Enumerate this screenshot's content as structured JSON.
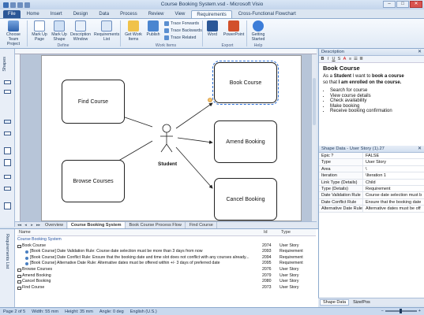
{
  "window": {
    "title": "Course Booking System.vsd - Microsoft Visio",
    "minimize": "–",
    "maximize": "□",
    "close": "✕"
  },
  "ribbon_tabs": [
    "File",
    "Home",
    "Insert",
    "Design",
    "Data",
    "Process",
    "Review",
    "View",
    "Requirements",
    "Cross-Functional Flowchart"
  ],
  "active_tab": "Requirements",
  "ribbon": {
    "choose_team_project": "Choose Team Project",
    "mark_up_page": "Mark Up Page",
    "mark_up_shape": "Mark Up Shape",
    "description_window": "Description Window",
    "requirements_list": "Requirements List",
    "get_work_items": "Get Work Items",
    "publish": "Publish",
    "trace_forwards": "Trace Forwards",
    "trace_backwards": "Trace Backwards",
    "trace_related": "Trace Related",
    "word": "Word",
    "powerpoint": "PowerPoint",
    "getting_started": "Getting Started",
    "group_define": "Define",
    "group_work_items": "Work Items",
    "group_export": "Export",
    "group_help": "Help"
  },
  "left_panel": {
    "label": "Shapes"
  },
  "diagram": {
    "shapes": {
      "find_course": "Find Course",
      "browse_courses": "Browse Courses",
      "book_course": "Book Course",
      "amend_booking": "Amend Booking",
      "cancel_booking": "Cancel Booking"
    },
    "actor": "Student"
  },
  "page_tabs": [
    "Overview",
    "Course Booking System",
    "Book Course Process Flow",
    "Find Course"
  ],
  "active_page": "Course Booking System",
  "requirements_list": {
    "side_label": "Requirements List",
    "columns": {
      "name": "Name",
      "id": "Id",
      "type": "Type"
    },
    "rows": [
      {
        "name": "Course Booking System",
        "id": "",
        "type": "",
        "kind": "group"
      },
      {
        "name": "Book Course",
        "id": "2074",
        "type": "User Story",
        "kind": "story"
      },
      {
        "name": "[Book Course] Date Validation Rule: Course date selection must be more than 3 days from now",
        "id": "2093",
        "type": "Requirement",
        "kind": "req"
      },
      {
        "name": "[Book Course] Date Conflict Rule: Ensure that the booking date and time slot does not conflict with any courses already...",
        "id": "2094",
        "type": "Requirement",
        "kind": "req"
      },
      {
        "name": "[Book Course] Alternative Date Rule: Alternative dates must be offered within +/- 3 days of preferred date",
        "id": "2095",
        "type": "Requirement",
        "kind": "req"
      },
      {
        "name": "Browse Courses",
        "id": "2076",
        "type": "User Story",
        "kind": "story"
      },
      {
        "name": "Amend Booking",
        "id": "2079",
        "type": "User Story",
        "kind": "story"
      },
      {
        "name": "Cancel Booking",
        "id": "2080",
        "type": "User Story",
        "kind": "story"
      },
      {
        "name": "Find Course",
        "id": "2073",
        "type": "User Story",
        "kind": "story"
      }
    ]
  },
  "description_panel": {
    "title": "Description",
    "heading": "Book Course",
    "line1_prefix": "As a ",
    "line1_bold1": "Student",
    "line1_mid": " I want to ",
    "line1_bold2": "book a course",
    "line2_prefix": "so that ",
    "line2_bold": "I am enrolled on the course.",
    "bullets": [
      "Search for course",
      "View course details",
      "Check availability",
      "Make booking",
      "Receive booking confirmation"
    ]
  },
  "shape_data": {
    "title": "Shape Data - User Story (1).27",
    "rows": [
      {
        "k": "Epic ?",
        "v": "FALSE"
      },
      {
        "k": "Type",
        "v": "User Story"
      },
      {
        "k": "Area",
        "v": "\\"
      },
      {
        "k": "Iteration",
        "v": "\\Iteration 1"
      },
      {
        "k": "Link Type (Details)",
        "v": "Child"
      },
      {
        "k": "Type (Details)",
        "v": "Requirement"
      },
      {
        "k": "Date Validation Rule",
        "v": "Course date selection must b"
      },
      {
        "k": "Date Conflict Rule",
        "v": "Ensure that the booking date"
      },
      {
        "k": "Alternative Date Rule",
        "v": "Alternative dates must be off"
      }
    ]
  },
  "right_tabs": [
    "Shape Data",
    "Size/Pos"
  ],
  "status": {
    "page": "Page 2 of 5",
    "width": "Width: 55 mm",
    "height": "Height: 35 mm",
    "angle": "Angle: 0 deg",
    "language": "English (U.S.)"
  }
}
